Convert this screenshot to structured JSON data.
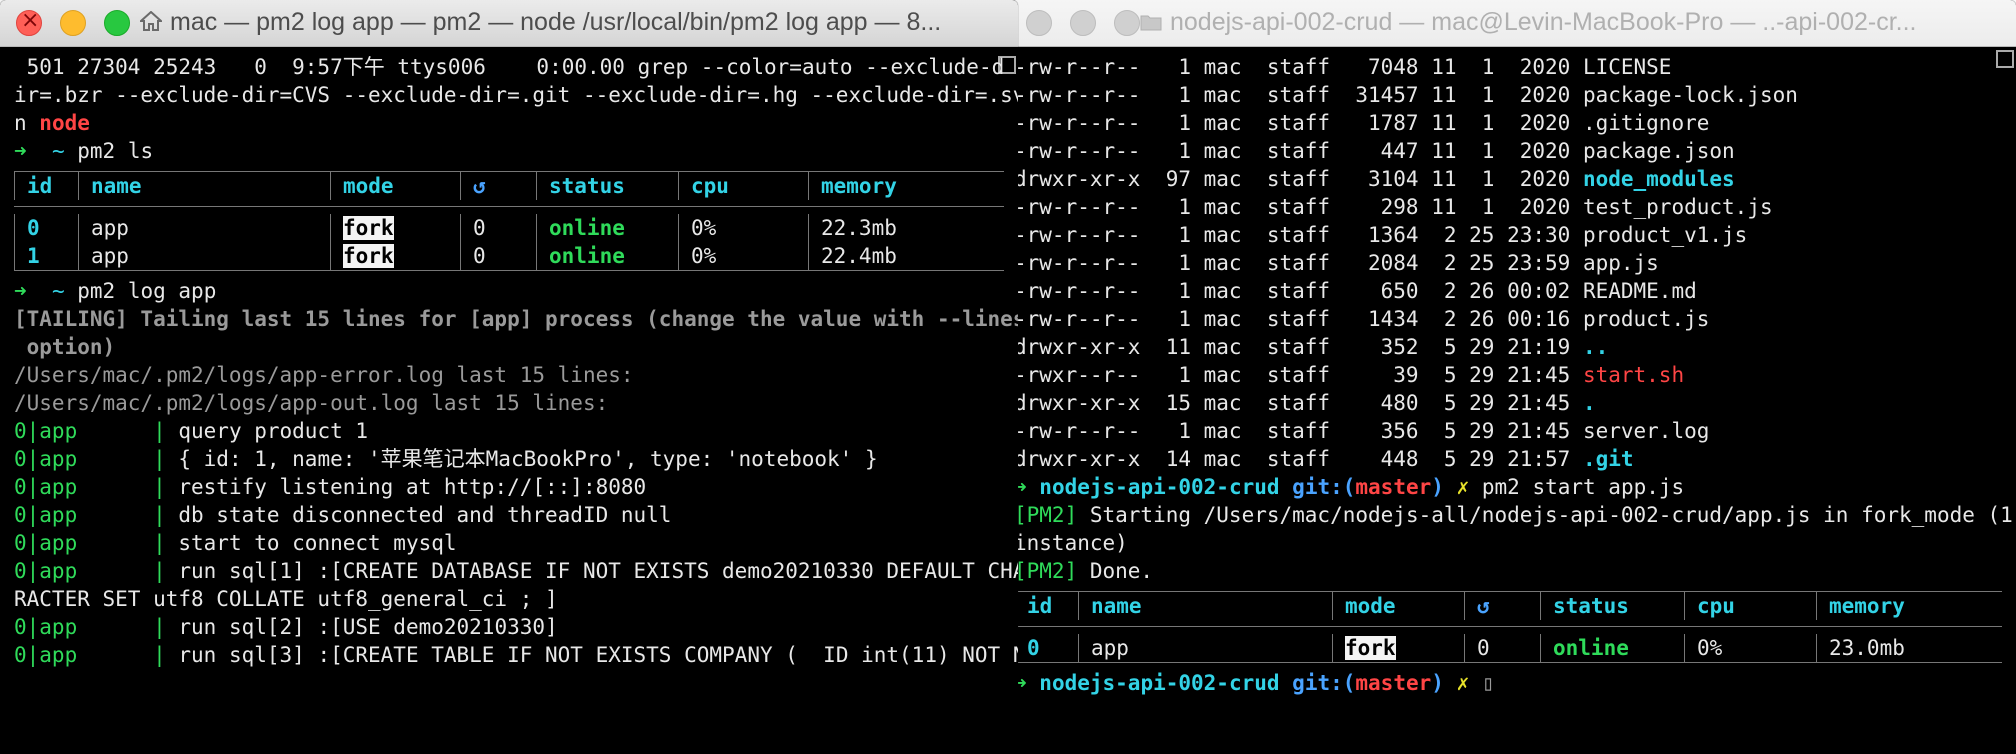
{
  "window_left": {
    "title": "mac — pm2 log app — pm2 — node /usr/local/bin/pm2 log app — 8...",
    "ps_line": " 501 27304 25243   0  9:57下午 ttys006    0:00.00 grep --color=auto --exclude-d",
    "ps_line2": "ir=.bzr --exclude-dir=CVS --exclude-dir=.git --exclude-dir=.hg --exclude-dir=.sv",
    "ps_line3_prefix": "n ",
    "ps_line3_match": "node",
    "prompt_arrow": "➜",
    "prompt_tilde": "~",
    "cmd1": "pm2 ls",
    "table": {
      "headers": [
        "id",
        "name",
        "mode",
        "↺",
        "status",
        "cpu",
        "memory"
      ],
      "rows": [
        {
          "id": "0",
          "name": "app",
          "mode": "fork",
          "restarts": "0",
          "status": "online",
          "cpu": "0%",
          "memory": "22.3mb"
        },
        {
          "id": "1",
          "name": "app",
          "mode": "fork",
          "restarts": "0",
          "status": "online",
          "cpu": "0%",
          "memory": "22.4mb"
        }
      ]
    },
    "cmd2": "pm2 log app",
    "tailing1": "[TAILING] Tailing last 15 lines for [app] process (change the value with --lines",
    "tailing2": " option)",
    "errlog": "/Users/mac/.pm2/logs/app-error.log last 15 lines:",
    "outlog": "/Users/mac/.pm2/logs/app-out.log last 15 lines:",
    "logs": [
      {
        "proc": "0|app",
        "text": "query product 1"
      },
      {
        "proc": "0|app",
        "text": "{ id: 1, name: '苹果笔记本MacBookPro', type: 'notebook' }"
      },
      {
        "proc": "0|app",
        "text": "restify listening at http://[::]:8080"
      },
      {
        "proc": "0|app",
        "text": "db state disconnected and threadID null"
      },
      {
        "proc": "0|app",
        "text": "start to connect mysql"
      },
      {
        "proc": "0|app",
        "text": "run sql[1] :[CREATE DATABASE IF NOT EXISTS demo20210330 DEFAULT CHA"
      },
      {
        "proc": "",
        "text": "RACTER SET utf8 COLLATE utf8_general_ci ; ]"
      },
      {
        "proc": "0|app",
        "text": "run sql[2] :[USE demo20210330]"
      },
      {
        "proc": "0|app",
        "text": "run sql[3] :[CREATE TABLE IF NOT EXISTS COMPANY (  ID int(11) NOT N"
      }
    ]
  },
  "window_right": {
    "title": "nodejs-api-002-crud — mac@Levin-MacBook-Pro — ..-api-002-cr...",
    "files": [
      {
        "perm": "-rw-r--r--",
        "links": "1",
        "user": "mac",
        "group": "staff",
        "size": "7048",
        "m": "11",
        "d": "1",
        "time": " 2020",
        "name": "LICENSE",
        "kind": "file"
      },
      {
        "perm": "-rw-r--r--",
        "links": "1",
        "user": "mac",
        "group": "staff",
        "size": "31457",
        "m": "11",
        "d": "1",
        "time": " 2020",
        "name": "package-lock.json",
        "kind": "file"
      },
      {
        "perm": "-rw-r--r--",
        "links": "1",
        "user": "mac",
        "group": "staff",
        "size": "1787",
        "m": "11",
        "d": "1",
        "time": " 2020",
        "name": ".gitignore",
        "kind": "file"
      },
      {
        "perm": "-rw-r--r--",
        "links": "1",
        "user": "mac",
        "group": "staff",
        "size": "447",
        "m": "11",
        "d": "1",
        "time": " 2020",
        "name": "package.json",
        "kind": "file"
      },
      {
        "perm": "drwxr-xr-x",
        "links": "97",
        "user": "mac",
        "group": "staff",
        "size": "3104",
        "m": "11",
        "d": "1",
        "time": " 2020",
        "name": "node_modules",
        "kind": "dir"
      },
      {
        "perm": "-rw-r--r--",
        "links": "1",
        "user": "mac",
        "group": "staff",
        "size": "298",
        "m": "11",
        "d": "1",
        "time": " 2020",
        "name": "test_product.js",
        "kind": "file"
      },
      {
        "perm": "-rw-r--r--",
        "links": "1",
        "user": "mac",
        "group": "staff",
        "size": "1364",
        "m": "2",
        "d": "25",
        "time": "23:30",
        "name": "product_v1.js",
        "kind": "file"
      },
      {
        "perm": "-rw-r--r--",
        "links": "1",
        "user": "mac",
        "group": "staff",
        "size": "2084",
        "m": "2",
        "d": "25",
        "time": "23:59",
        "name": "app.js",
        "kind": "file"
      },
      {
        "perm": "-rw-r--r--",
        "links": "1",
        "user": "mac",
        "group": "staff",
        "size": "650",
        "m": "2",
        "d": "26",
        "time": "00:02",
        "name": "README.md",
        "kind": "file"
      },
      {
        "perm": "-rw-r--r--",
        "links": "1",
        "user": "mac",
        "group": "staff",
        "size": "1434",
        "m": "2",
        "d": "26",
        "time": "00:16",
        "name": "product.js",
        "kind": "file"
      },
      {
        "perm": "drwxr-xr-x",
        "links": "11",
        "user": "mac",
        "group": "staff",
        "size": "352",
        "m": "5",
        "d": "29",
        "time": "21:19",
        "name": "..",
        "kind": "dir"
      },
      {
        "perm": "-rwxr--r--",
        "links": "1",
        "user": "mac",
        "group": "staff",
        "size": "39",
        "m": "5",
        "d": "29",
        "time": "21:45",
        "name": "start.sh",
        "kind": "exec"
      },
      {
        "perm": "drwxr-xr-x",
        "links": "15",
        "user": "mac",
        "group": "staff",
        "size": "480",
        "m": "5",
        "d": "29",
        "time": "21:45",
        "name": ".",
        "kind": "dir"
      },
      {
        "perm": "-rw-r--r--",
        "links": "1",
        "user": "mac",
        "group": "staff",
        "size": "356",
        "m": "5",
        "d": "29",
        "time": "21:45",
        "name": "server.log",
        "kind": "file"
      },
      {
        "perm": "drwxr-xr-x",
        "links": "14",
        "user": "mac",
        "group": "staff",
        "size": "448",
        "m": "5",
        "d": "29",
        "time": "21:57",
        "name": ".git",
        "kind": "dir"
      }
    ],
    "prompt_dir": "nodejs-api-002-crud",
    "git_label": "git:(",
    "git_branch": "master",
    "git_close": ")",
    "dirty_mark": "✗",
    "cmd": "pm2 start app.js",
    "pm2_tag": "[PM2]",
    "starting1": " Starting /Users/mac/nodejs-all/nodejs-api-002-crud/app.js in fork_mode (1",
    "starting2": "instance)",
    "done": " Done.",
    "table": {
      "headers": [
        "id",
        "name",
        "mode",
        "↺",
        "status",
        "cpu",
        "memory"
      ],
      "rows": [
        {
          "id": "0",
          "name": "app",
          "mode": "fork",
          "restarts": "0",
          "status": "online",
          "cpu": "0%",
          "memory": "23.0mb"
        }
      ]
    },
    "cursor": "▯"
  }
}
